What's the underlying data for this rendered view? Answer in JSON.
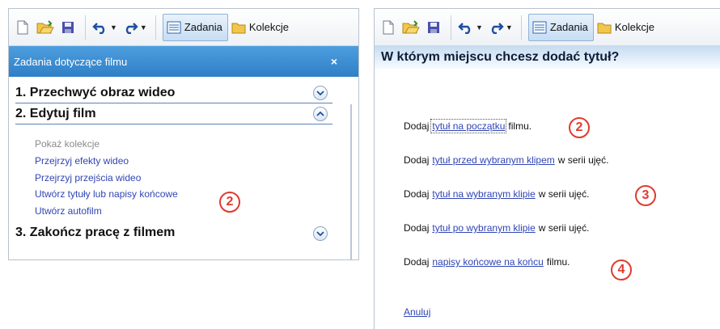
{
  "left": {
    "toolbar": {
      "tasks_label": "Zadania",
      "collections_label": "Kolekcje"
    },
    "pane_title": "Zadania dotyczące filmu",
    "close_glyph": "×",
    "sections": [
      {
        "title": "1. Przechwyć obraz wideo",
        "chevron": "down"
      },
      {
        "title": "2. Edytuj film",
        "chevron": "up"
      },
      {
        "title": "3. Zakończ pracę z filmem",
        "chevron": "down"
      }
    ],
    "tasks": [
      {
        "label": "Pokaż kolekcje",
        "enabled": false
      },
      {
        "label": "Przejrzyj efekty wideo",
        "enabled": true
      },
      {
        "label": "Przejrzyj przejścia wideo",
        "enabled": true
      },
      {
        "label": "Utwórz tytuły lub napisy końcowe",
        "enabled": true
      },
      {
        "label": "Utwórz autofilm",
        "enabled": true
      }
    ],
    "callout": "2"
  },
  "right": {
    "toolbar": {
      "tasks_label": "Zadania",
      "collections_label": "Kolekcje"
    },
    "heading": "W którym miejscu chcesz dodać tytuł?",
    "options": [
      {
        "prefix": "Dodaj",
        "link": "tytuł na początku",
        "suffix": "filmu.",
        "callout": "2"
      },
      {
        "prefix": "Dodaj",
        "link": "tytuł przed wybranym klipem",
        "suffix": "w serii ujęć.",
        "callout": ""
      },
      {
        "prefix": "Dodaj",
        "link": "tytuł na wybranym klipie",
        "suffix": "w serii ujęć.",
        "callout": "3"
      },
      {
        "prefix": "Dodaj",
        "link": "tytuł po wybranym klipie",
        "suffix": "w serii ujęć.",
        "callout": ""
      },
      {
        "prefix": "Dodaj",
        "link": "napisy końcowe na końcu",
        "suffix": "filmu.",
        "callout": "4"
      }
    ],
    "cancel_label": "Anuluj"
  },
  "colors": {
    "accent_blue": "#2f7fc7",
    "link": "#3045b4",
    "callout_red": "#e03a2e"
  }
}
